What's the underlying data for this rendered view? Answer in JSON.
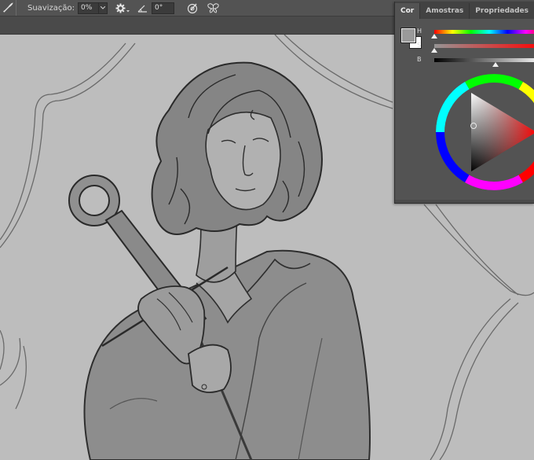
{
  "options_bar": {
    "tool_icon": "brush-settings-icon",
    "smoothing_label": "Suavização:",
    "smoothing_value": "0%",
    "gear_icon": "gear-icon",
    "angle_icon": "angle-icon",
    "angle_value": "0°",
    "pressure_icon": "pressure-brush-icon",
    "symmetry_icon": "symmetry-butterfly-icon"
  },
  "color_panel": {
    "tabs": [
      {
        "label": "Cor",
        "active": true
      },
      {
        "label": "Amostras",
        "active": false
      },
      {
        "label": "Propriedades",
        "active": false
      }
    ],
    "foreground_color": "#9a9a9a",
    "background_color": "#ffffff",
    "sliders": [
      {
        "label": "H",
        "value": 0
      },
      {
        "label": "S",
        "value": 0
      },
      {
        "label": "B",
        "value": 58
      }
    ]
  },
  "canvas": {
    "artwork": "sketch-of-person-holding-key"
  }
}
